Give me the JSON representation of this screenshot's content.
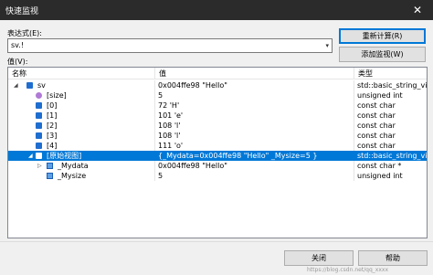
{
  "window": {
    "title": "快速监视",
    "close_glyph": "✕"
  },
  "expression": {
    "label": "表达式(E):",
    "value": "sv.!",
    "dropdown_glyph": "▾"
  },
  "buttons": {
    "recalculate": "重新计算(R)",
    "add_watch": "添加监视(W)",
    "close": "关闭",
    "help": "帮助"
  },
  "value_label": "值(V):",
  "columns": {
    "name": "名称",
    "value": "值",
    "type": "类型"
  },
  "rows": [
    {
      "twisty": "◢",
      "icon": "obj",
      "name": "sv",
      "value": "0x004ffe98 \"Hello\"",
      "type": "std::basic_string_vi..."
    },
    {
      "twisty": "",
      "icon": "size",
      "name": "[size]",
      "value": "5",
      "type": "unsigned int"
    },
    {
      "twisty": "",
      "icon": "obj",
      "name": "[0]",
      "value": "72 'H'",
      "type": "const char"
    },
    {
      "twisty": "",
      "icon": "obj",
      "name": "[1]",
      "value": "101 'e'",
      "type": "const char"
    },
    {
      "twisty": "",
      "icon": "obj",
      "name": "[2]",
      "value": "108 'l'",
      "type": "const char"
    },
    {
      "twisty": "",
      "icon": "obj",
      "name": "[3]",
      "value": "108 'l'",
      "type": "const char"
    },
    {
      "twisty": "",
      "icon": "obj",
      "name": "[4]",
      "value": "111 'o'",
      "type": "const char"
    },
    {
      "twisty": "◢",
      "icon": "obj",
      "name": "[原始视图]",
      "value": "{_Mydata=0x004ffe98 \"Hello\" _Mysize=5 }",
      "type": "std::basic_string_vi..."
    },
    {
      "twisty": "▷",
      "icon": "field",
      "name": "_Mydata",
      "value": "0x004ffe98 \"Hello\"",
      "type": "const char *"
    },
    {
      "twisty": "",
      "icon": "field",
      "name": "_Mysize",
      "value": "5",
      "type": "unsigned int"
    }
  ],
  "selected_row_index": 7,
  "inline_tools": {
    "magnifier": "🔍",
    "dropdown": "▾"
  },
  "watermark": "https://blog.csdn.net/qq_xxxx",
  "colors": {
    "selection": "#0078d7",
    "titlebar": "#2b2b2b"
  }
}
